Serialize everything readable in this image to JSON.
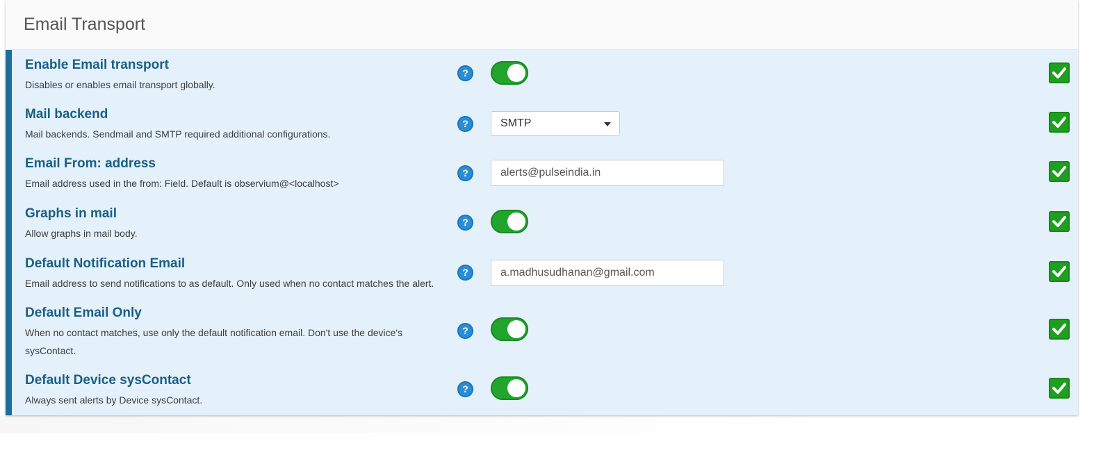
{
  "panel": {
    "title": "Email Transport"
  },
  "icons": {
    "help": "question-circle-icon",
    "saved": "check-square-icon",
    "dropdown": "caret-down-icon"
  },
  "colors": {
    "accent_border": "#1a6e9f",
    "row_background": "#e4f1fb",
    "title_text": "#1a5f84",
    "toggle_on": "#21a52c",
    "check_green": "#1f9f1f",
    "help_blue": "#2a8ed6"
  },
  "settings": [
    {
      "title": "Enable Email transport",
      "description": "Disables or enables email transport globally.",
      "control": "toggle",
      "enabled": true,
      "help_glyph": "?"
    },
    {
      "title": "Mail backend",
      "description": "Mail backends. Sendmail and SMTP required additional configurations.",
      "control": "select",
      "value": "SMTP",
      "help_glyph": "?"
    },
    {
      "title": "Email From: address",
      "description": "Email address used in the from: Field. Default is observium@<localhost>",
      "control": "text",
      "value": "alerts@pulseindia.in",
      "help_glyph": "?"
    },
    {
      "title": "Graphs in mail",
      "description": "Allow graphs in mail body.",
      "control": "toggle",
      "enabled": true,
      "help_glyph": "?"
    },
    {
      "title": "Default Notification Email",
      "description": "Email address to send notifications to as default. Only used when no contact matches the alert.",
      "control": "text",
      "value": "a.madhusudhanan@gmail.com",
      "help_glyph": "?"
    },
    {
      "title": "Default Email Only",
      "description": "When no contact matches, use only the default notification email. Don't use the device's sysContact.",
      "control": "toggle",
      "enabled": true,
      "help_glyph": "?"
    },
    {
      "title": "Default Device sysContact",
      "description": "Always sent alerts by Device sysContact.",
      "control": "toggle",
      "enabled": true,
      "help_glyph": "?"
    }
  ]
}
